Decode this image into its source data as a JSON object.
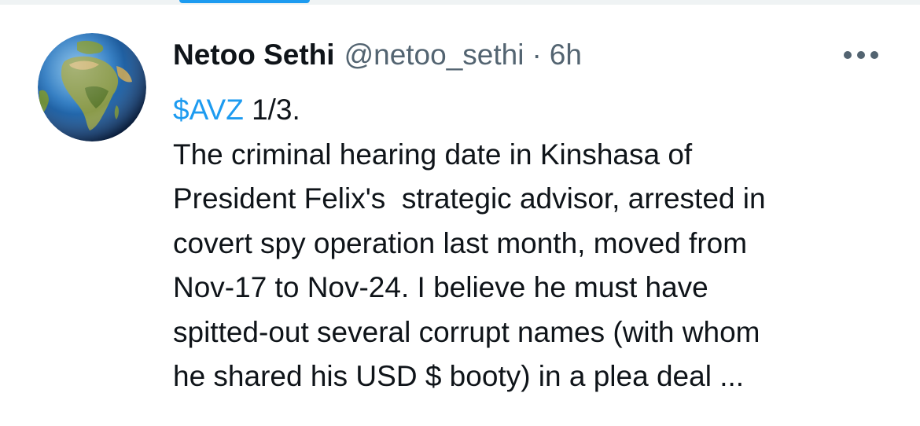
{
  "tweet": {
    "author": {
      "display_name": "Netoo Sethi",
      "handle": "@netoo_sethi",
      "avatar_icon": "globe-africa-icon"
    },
    "separator": "·",
    "timestamp": "6h",
    "more_icon": "more-horizontal-icon",
    "cashtag": "$AVZ",
    "first_line_rest": " 1/3.",
    "lines": [
      "The criminal hearing date in Kinshasa of",
      "President Felix's  strategic advisor, arrested in",
      "covert spy operation last month, moved from",
      "Nov-17 to Nov-24. I believe he must have",
      "spitted-out several corrupt names (with whom",
      "he shared his USD $ booty) in a plea deal ..."
    ]
  },
  "colors": {
    "accent": "#1d9bf0",
    "primary_text": "#0f1419",
    "secondary_text": "#536471",
    "divider": "#eff3f4"
  }
}
